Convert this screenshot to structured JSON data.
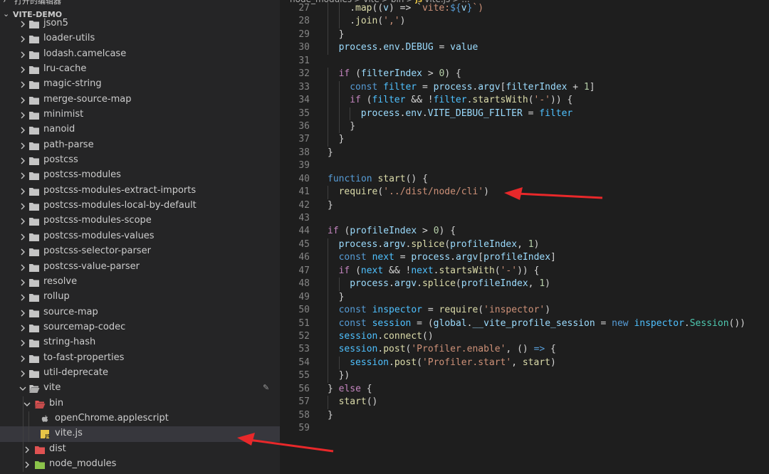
{
  "sidebar": {
    "top_partial": "打开的编辑器",
    "project_title": "VITE-DEMO",
    "items": [
      {
        "label": "json5",
        "depth": 1,
        "type": "folder",
        "expanded": false
      },
      {
        "label": "loader-utils",
        "depth": 1,
        "type": "folder",
        "expanded": false
      },
      {
        "label": "lodash.camelcase",
        "depth": 1,
        "type": "folder",
        "expanded": false
      },
      {
        "label": "lru-cache",
        "depth": 1,
        "type": "folder",
        "expanded": false
      },
      {
        "label": "magic-string",
        "depth": 1,
        "type": "folder",
        "expanded": false
      },
      {
        "label": "merge-source-map",
        "depth": 1,
        "type": "folder",
        "expanded": false
      },
      {
        "label": "minimist",
        "depth": 1,
        "type": "folder",
        "expanded": false
      },
      {
        "label": "nanoid",
        "depth": 1,
        "type": "folder",
        "expanded": false
      },
      {
        "label": "path-parse",
        "depth": 1,
        "type": "folder",
        "expanded": false
      },
      {
        "label": "postcss",
        "depth": 1,
        "type": "folder",
        "expanded": false
      },
      {
        "label": "postcss-modules",
        "depth": 1,
        "type": "folder",
        "expanded": false
      },
      {
        "label": "postcss-modules-extract-imports",
        "depth": 1,
        "type": "folder",
        "expanded": false
      },
      {
        "label": "postcss-modules-local-by-default",
        "depth": 1,
        "type": "folder",
        "expanded": false
      },
      {
        "label": "postcss-modules-scope",
        "depth": 1,
        "type": "folder",
        "expanded": false
      },
      {
        "label": "postcss-modules-values",
        "depth": 1,
        "type": "folder",
        "expanded": false
      },
      {
        "label": "postcss-selector-parser",
        "depth": 1,
        "type": "folder",
        "expanded": false
      },
      {
        "label": "postcss-value-parser",
        "depth": 1,
        "type": "folder",
        "expanded": false
      },
      {
        "label": "resolve",
        "depth": 1,
        "type": "folder",
        "expanded": false
      },
      {
        "label": "rollup",
        "depth": 1,
        "type": "folder",
        "expanded": false
      },
      {
        "label": "source-map",
        "depth": 1,
        "type": "folder",
        "expanded": false
      },
      {
        "label": "sourcemap-codec",
        "depth": 1,
        "type": "folder",
        "expanded": false
      },
      {
        "label": "string-hash",
        "depth": 1,
        "type": "folder",
        "expanded": false
      },
      {
        "label": "to-fast-properties",
        "depth": 1,
        "type": "folder",
        "expanded": false
      },
      {
        "label": "util-deprecate",
        "depth": 1,
        "type": "folder",
        "expanded": false
      },
      {
        "label": "vite",
        "depth": 1,
        "type": "folder-open",
        "expanded": true
      },
      {
        "label": "bin",
        "depth": 2,
        "type": "folder-red-open",
        "expanded": true
      },
      {
        "label": "openChrome.applescript",
        "depth": 3,
        "type": "apple-file"
      },
      {
        "label": "vite.js",
        "depth": 3,
        "type": "js-file",
        "selected": true
      },
      {
        "label": "dist",
        "depth": 2,
        "type": "folder-red",
        "expanded": false
      },
      {
        "label": "node_modules",
        "depth": 2,
        "type": "folder-green",
        "expanded": false
      }
    ]
  },
  "breadcrumb": [
    "node_modules",
    ">",
    "vite",
    ">",
    "bin",
    ">",
    "JS",
    "vite.js",
    ">",
    "..."
  ],
  "code": {
    "lines": [
      {
        "n": "27",
        "indent": 2,
        "tokens": [
          [
            ".",
            "op"
          ],
          [
            "map",
            "fn"
          ],
          [
            "((",
            "op"
          ],
          [
            "v",
            "var"
          ],
          [
            ") => `",
            "op"
          ],
          [
            "vite:",
            "str"
          ],
          [
            "${",
            "tplv"
          ],
          [
            "v",
            "var"
          ],
          [
            "}",
            "tplv"
          ],
          [
            "`)",
            "str"
          ]
        ]
      },
      {
        "n": "28",
        "indent": 2,
        "tokens": [
          [
            ".",
            "op"
          ],
          [
            "join",
            "fn"
          ],
          [
            "(",
            "op"
          ],
          [
            "','",
            "str"
          ],
          [
            ")",
            "op"
          ]
        ]
      },
      {
        "n": "29",
        "indent": 1,
        "tokens": [
          [
            "}",
            "op"
          ]
        ]
      },
      {
        "n": "30",
        "indent": 1,
        "tokens": [
          [
            "process",
            "var"
          ],
          [
            ".",
            "op"
          ],
          [
            "env",
            "var"
          ],
          [
            ".",
            "op"
          ],
          [
            "DEBUG",
            "prop"
          ],
          [
            " = ",
            "op"
          ],
          [
            "value",
            "var"
          ]
        ]
      },
      {
        "n": "31",
        "indent": 0,
        "tokens": []
      },
      {
        "n": "32",
        "indent": 1,
        "tokens": [
          [
            "if",
            "ctl"
          ],
          [
            " (",
            "op"
          ],
          [
            "filterIndex",
            "var"
          ],
          [
            " > ",
            "op"
          ],
          [
            "0",
            "num"
          ],
          [
            ") {",
            "op"
          ]
        ]
      },
      {
        "n": "33",
        "indent": 2,
        "tokens": [
          [
            "const",
            "kw"
          ],
          [
            " ",
            "op"
          ],
          [
            "filter",
            "cst"
          ],
          [
            " = ",
            "op"
          ],
          [
            "process",
            "var"
          ],
          [
            ".",
            "op"
          ],
          [
            "argv",
            "var"
          ],
          [
            "[",
            "op"
          ],
          [
            "filterIndex",
            "var"
          ],
          [
            " + ",
            "op"
          ],
          [
            "1",
            "num"
          ],
          [
            "]",
            "op"
          ]
        ]
      },
      {
        "n": "34",
        "indent": 2,
        "tokens": [
          [
            "if",
            "ctl"
          ],
          [
            " (",
            "op"
          ],
          [
            "filter",
            "cst"
          ],
          [
            " && !",
            "op"
          ],
          [
            "filter",
            "cst"
          ],
          [
            ".",
            "op"
          ],
          [
            "startsWith",
            "fn"
          ],
          [
            "(",
            "op"
          ],
          [
            "'-'",
            "str"
          ],
          [
            ")) {",
            "op"
          ]
        ]
      },
      {
        "n": "35",
        "indent": 3,
        "tokens": [
          [
            "process",
            "var"
          ],
          [
            ".",
            "op"
          ],
          [
            "env",
            "var"
          ],
          [
            ".",
            "op"
          ],
          [
            "VITE_DEBUG_FILTER",
            "prop"
          ],
          [
            " = ",
            "op"
          ],
          [
            "filter",
            "cst"
          ]
        ]
      },
      {
        "n": "36",
        "indent": 2,
        "tokens": [
          [
            "}",
            "op"
          ]
        ]
      },
      {
        "n": "37",
        "indent": 1,
        "tokens": [
          [
            "}",
            "op"
          ]
        ]
      },
      {
        "n": "38",
        "indent": 0,
        "tokens": [
          [
            "}",
            "op"
          ]
        ]
      },
      {
        "n": "39",
        "indent": 0,
        "tokens": []
      },
      {
        "n": "40",
        "indent": 0,
        "tokens": [
          [
            "function",
            "kw"
          ],
          [
            " ",
            "op"
          ],
          [
            "start",
            "fn"
          ],
          [
            "() {",
            "op"
          ]
        ]
      },
      {
        "n": "41",
        "indent": 1,
        "tokens": [
          [
            "require",
            "fn"
          ],
          [
            "(",
            "op"
          ],
          [
            "'../dist/node/cli'",
            "str"
          ],
          [
            ")",
            "op"
          ]
        ]
      },
      {
        "n": "42",
        "indent": 0,
        "tokens": [
          [
            "}",
            "op"
          ]
        ]
      },
      {
        "n": "43",
        "indent": 0,
        "tokens": []
      },
      {
        "n": "44",
        "indent": 0,
        "tokens": [
          [
            "if",
            "ctl"
          ],
          [
            " (",
            "op"
          ],
          [
            "profileIndex",
            "var"
          ],
          [
            " > ",
            "op"
          ],
          [
            "0",
            "num"
          ],
          [
            ") {",
            "op"
          ]
        ]
      },
      {
        "n": "45",
        "indent": 1,
        "tokens": [
          [
            "process",
            "var"
          ],
          [
            ".",
            "op"
          ],
          [
            "argv",
            "var"
          ],
          [
            ".",
            "op"
          ],
          [
            "splice",
            "fn"
          ],
          [
            "(",
            "op"
          ],
          [
            "profileIndex",
            "var"
          ],
          [
            ", ",
            "op"
          ],
          [
            "1",
            "num"
          ],
          [
            ")",
            "op"
          ]
        ]
      },
      {
        "n": "46",
        "indent": 1,
        "tokens": [
          [
            "const",
            "kw"
          ],
          [
            " ",
            "op"
          ],
          [
            "next",
            "cst"
          ],
          [
            " = ",
            "op"
          ],
          [
            "process",
            "var"
          ],
          [
            ".",
            "op"
          ],
          [
            "argv",
            "var"
          ],
          [
            "[",
            "op"
          ],
          [
            "profileIndex",
            "var"
          ],
          [
            "]",
            "op"
          ]
        ]
      },
      {
        "n": "47",
        "indent": 1,
        "tokens": [
          [
            "if",
            "ctl"
          ],
          [
            " (",
            "op"
          ],
          [
            "next",
            "cst"
          ],
          [
            " && !",
            "op"
          ],
          [
            "next",
            "cst"
          ],
          [
            ".",
            "op"
          ],
          [
            "startsWith",
            "fn"
          ],
          [
            "(",
            "op"
          ],
          [
            "'-'",
            "str"
          ],
          [
            ")) {",
            "op"
          ]
        ]
      },
      {
        "n": "48",
        "indent": 2,
        "tokens": [
          [
            "process",
            "var"
          ],
          [
            ".",
            "op"
          ],
          [
            "argv",
            "var"
          ],
          [
            ".",
            "op"
          ],
          [
            "splice",
            "fn"
          ],
          [
            "(",
            "op"
          ],
          [
            "profileIndex",
            "var"
          ],
          [
            ", ",
            "op"
          ],
          [
            "1",
            "num"
          ],
          [
            ")",
            "op"
          ]
        ]
      },
      {
        "n": "49",
        "indent": 1,
        "tokens": [
          [
            "}",
            "op"
          ]
        ]
      },
      {
        "n": "50",
        "indent": 1,
        "tokens": [
          [
            "const",
            "kw"
          ],
          [
            " ",
            "op"
          ],
          [
            "inspector",
            "cst"
          ],
          [
            " = ",
            "op"
          ],
          [
            "require",
            "fn"
          ],
          [
            "(",
            "op"
          ],
          [
            "'inspector'",
            "str"
          ],
          [
            ")",
            "op"
          ]
        ]
      },
      {
        "n": "51",
        "indent": 1,
        "tokens": [
          [
            "const",
            "kw"
          ],
          [
            " ",
            "op"
          ],
          [
            "session",
            "cst"
          ],
          [
            " = (",
            "op"
          ],
          [
            "global",
            "var"
          ],
          [
            ".",
            "op"
          ],
          [
            "__vite_profile_session",
            "var"
          ],
          [
            " = ",
            "op"
          ],
          [
            "new",
            "kw"
          ],
          [
            " ",
            "op"
          ],
          [
            "inspector",
            "cst"
          ],
          [
            ".",
            "op"
          ],
          [
            "Session",
            "cls"
          ],
          [
            "())",
            "op"
          ]
        ]
      },
      {
        "n": "52",
        "indent": 1,
        "tokens": [
          [
            "session",
            "cst"
          ],
          [
            ".",
            "op"
          ],
          [
            "connect",
            "fn"
          ],
          [
            "()",
            "op"
          ]
        ]
      },
      {
        "n": "53",
        "indent": 1,
        "tokens": [
          [
            "session",
            "cst"
          ],
          [
            ".",
            "op"
          ],
          [
            "post",
            "fn"
          ],
          [
            "(",
            "op"
          ],
          [
            "'Profiler.enable'",
            "str"
          ],
          [
            ", () ",
            "op"
          ],
          [
            "=>",
            "kw"
          ],
          [
            " {",
            "op"
          ]
        ]
      },
      {
        "n": "54",
        "indent": 2,
        "tokens": [
          [
            "session",
            "cst"
          ],
          [
            ".",
            "op"
          ],
          [
            "post",
            "fn"
          ],
          [
            "(",
            "op"
          ],
          [
            "'Profiler.start'",
            "str"
          ],
          [
            ", ",
            "op"
          ],
          [
            "start",
            "fn"
          ],
          [
            ")",
            "op"
          ]
        ]
      },
      {
        "n": "55",
        "indent": 1,
        "tokens": [
          [
            "})",
            "op"
          ]
        ]
      },
      {
        "n": "56",
        "indent": 0,
        "tokens": [
          [
            "} ",
            "op"
          ],
          [
            "else",
            "ctl"
          ],
          [
            " {",
            "op"
          ]
        ]
      },
      {
        "n": "57",
        "indent": 1,
        "tokens": [
          [
            "start",
            "fn"
          ],
          [
            "()",
            "op"
          ]
        ]
      },
      {
        "n": "58",
        "indent": 0,
        "tokens": [
          [
            "}",
            "op"
          ]
        ]
      },
      {
        "n": "59",
        "indent": 0,
        "tokens": []
      }
    ]
  },
  "colors": {
    "sidebar_bg": "#252526",
    "editor_bg": "#1e1e1e",
    "selected_row": "#37373d",
    "arrow_red": "#e8282a",
    "folder_gray": "#c5c5c5",
    "folder_red": "#e05252",
    "folder_green": "#8bc34a",
    "js_yellow": "#e8c547"
  },
  "annotations": [
    {
      "name": "arrow-to-require-line",
      "icon": "red-arrow"
    },
    {
      "name": "arrow-to-vite-js",
      "icon": "red-arrow"
    }
  ]
}
